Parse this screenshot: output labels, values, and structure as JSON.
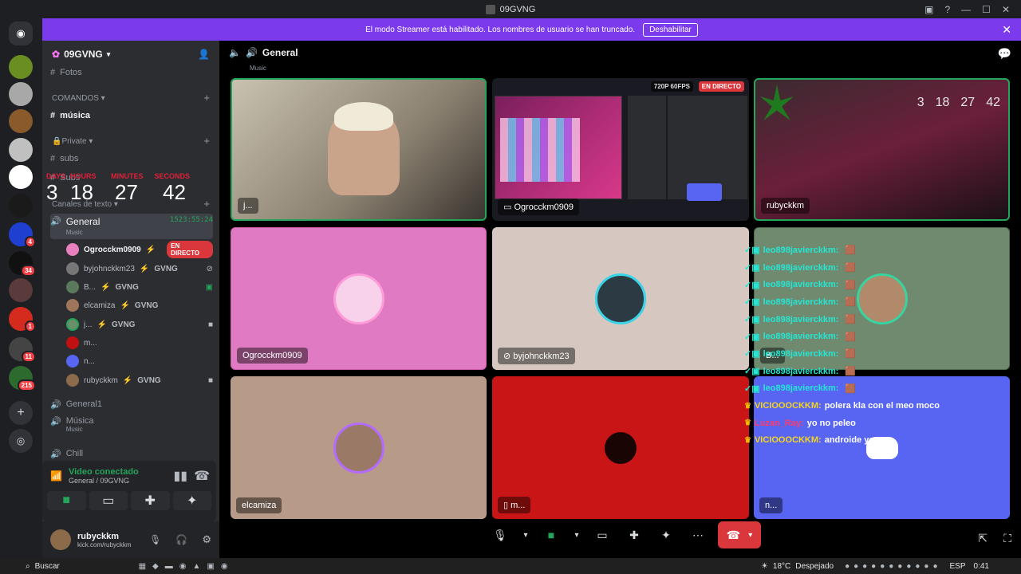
{
  "window": {
    "title": "09GVNG"
  },
  "banner": {
    "message": "El modo Streamer está habilitado. Los nombres de usuario se han truncado.",
    "button": "Deshabilitar"
  },
  "guild_badges": [
    "4",
    "34",
    "1",
    "11",
    "215"
  ],
  "server": {
    "name": "09GVNG"
  },
  "channels": {
    "fotos": "Fotos",
    "cat_comandos": "COMANDOS",
    "musica": "música",
    "cat_private": "Private",
    "subs": "subs",
    "subs2": "Subs",
    "cat_texto": "Canales de texto",
    "general": "General",
    "general_sub": "Music",
    "general_time": "1523:55:24",
    "general1": "General1",
    "musica2": "Música",
    "musica2_sub": "Music",
    "chill": "Chill"
  },
  "timer": {
    "labels": [
      "DAYS",
      "HOURS",
      "MINUTES",
      "SECONDS"
    ],
    "values": [
      "3",
      "18",
      "27",
      "42"
    ]
  },
  "voice_users": [
    {
      "name": "Ogrocckm0909",
      "tag": "",
      "live": "EN DIRECTO"
    },
    {
      "name": "byjohnckkm23",
      "tag": "GVNG",
      "live": ""
    },
    {
      "name": "B...",
      "tag": "GVNG",
      "live": ""
    },
    {
      "name": "elcamiza",
      "tag": "GVNG",
      "live": ""
    },
    {
      "name": "j...",
      "tag": "GVNG",
      "live": ""
    },
    {
      "name": "m...",
      "tag": "",
      "live": ""
    },
    {
      "name": "n...",
      "tag": "",
      "live": ""
    },
    {
      "name": "rubyckkm",
      "tag": "GVNG",
      "live": ""
    }
  ],
  "vc_panel": {
    "status": "Video conectado",
    "location": "General / 09GVNG"
  },
  "user_panel": {
    "name": "rubyckkm",
    "status": "kick.com/rubyckkm"
  },
  "header": {
    "channel": "General",
    "sub": "Music"
  },
  "tiles": {
    "t1": "j...",
    "t2": "Ogrocckm0909",
    "t2_badge_fps": "720P 60FPS",
    "t2_badge_live": "EN DIRECTO",
    "t3": "rubyckkm",
    "t4": "Ogrocckm0909",
    "t5": "byjohnckkm23",
    "t6": "B...",
    "t7": "elcamiza",
    "t8": "m...",
    "t9": "n..."
  },
  "overlay_timer": {
    "values": [
      "3",
      "18",
      "27",
      "42"
    ]
  },
  "chat": [
    {
      "user": "leo898javierckkm:",
      "text": ""
    },
    {
      "user": "leo898javierckkm:",
      "text": ""
    },
    {
      "user": "leo898javierckkm:",
      "text": ""
    },
    {
      "user": "leo898javierckkm:",
      "text": ""
    },
    {
      "user": "leo898javierckkm:",
      "text": ""
    },
    {
      "user": "leo898javierckkm:",
      "text": ""
    },
    {
      "user": "leo898javierckkm:",
      "text": ""
    },
    {
      "user": "leo898javierckkm:",
      "text": ""
    },
    {
      "user": "leo898javierckkm:",
      "text": ""
    },
    {
      "user": "VICIOOOCKKM:",
      "text": "polera kla con el meo moco"
    },
    {
      "user": "Luzan_Ray:",
      "text": "yo no peleo"
    },
    {
      "user": "VICIOOOCKKM:",
      "text": "androide yose"
    }
  ],
  "taskbar": {
    "search": "Buscar",
    "weather": "18°C",
    "weather_text": "Despejado",
    "lang": "ESP",
    "time": "0:41"
  },
  "colors": {
    "banner": "#7c3aed",
    "live": "#da373c",
    "speaking": "#23a55a"
  }
}
